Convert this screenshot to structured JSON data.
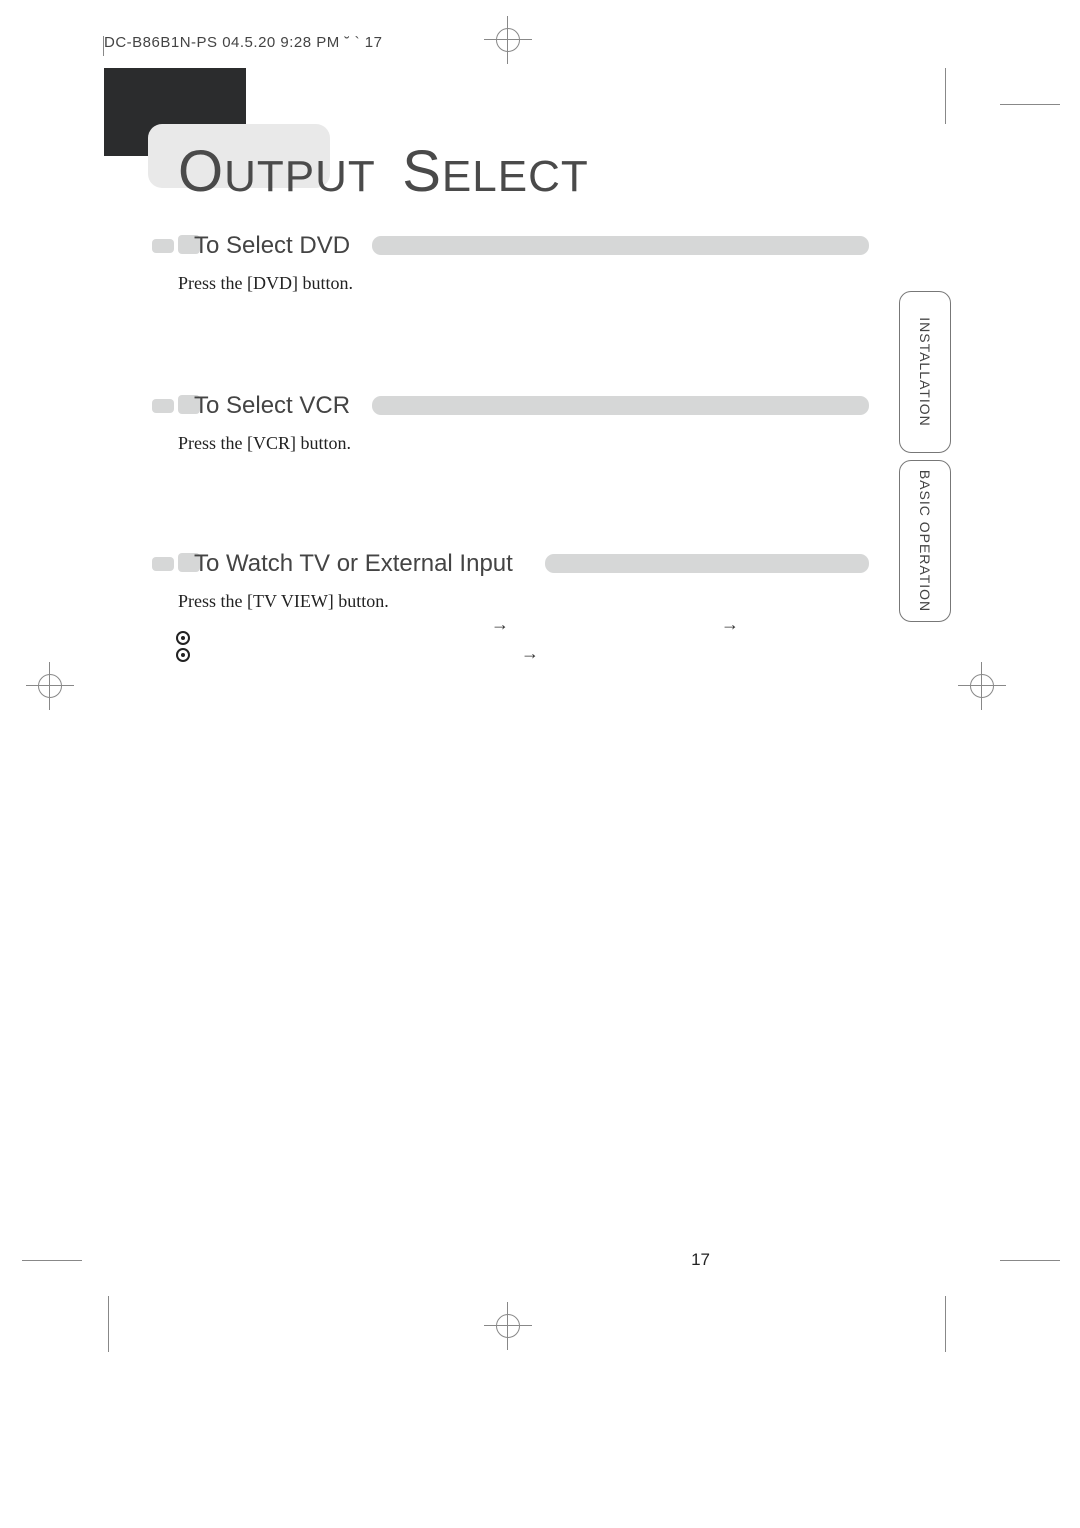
{
  "slug": "DC-B86B1N-PS   04.5.20  9:28 PM  ˘ ` 17",
  "title": {
    "word1_first": "O",
    "word1_rest": "UTPUT",
    "word2_first": "S",
    "word2_rest": "ELECT"
  },
  "sections": [
    {
      "heading": "To Select DVD",
      "body": "Press the [DVD] button."
    },
    {
      "heading": "To Select VCR",
      "body": "Press the [VCR] button."
    },
    {
      "heading": "To Watch TV or External Input",
      "body": "Press the [TV VIEW] button."
    }
  ],
  "arrows": [
    "→",
    "→",
    "→"
  ],
  "side_tabs": [
    "INSTALLATION",
    "BASIC OPERATION"
  ],
  "page_number": "17"
}
